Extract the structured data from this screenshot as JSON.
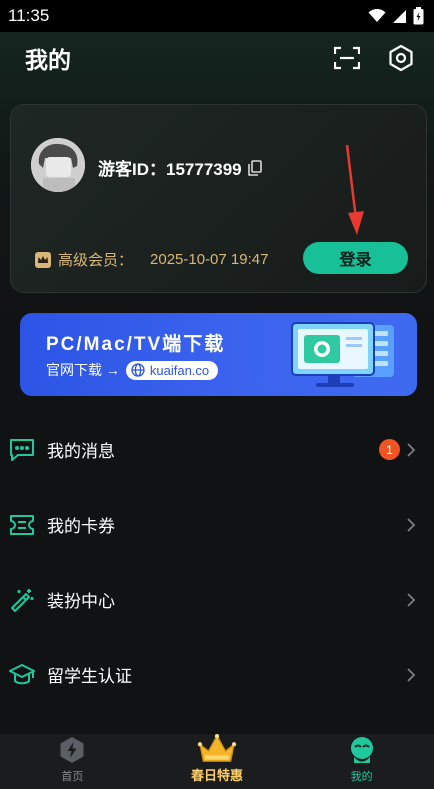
{
  "status_bar": {
    "time": "11:35"
  },
  "header": {
    "title": "我的"
  },
  "profile": {
    "guest_id": "游客ID：15777399",
    "member_label": "高级会员：",
    "member_expiry": "2025-10-07 19:47",
    "login_label": "登录"
  },
  "banner": {
    "title": "PC/Mac/TV端下载",
    "subtitle": "官网下载 →",
    "url": "kuaifan.co"
  },
  "menu": {
    "items": [
      {
        "label": "我的消息",
        "badge": "1"
      },
      {
        "label": "我的卡券"
      },
      {
        "label": "装扮中心"
      },
      {
        "label": "留学生认证"
      }
    ]
  },
  "tabbar": {
    "tabs": [
      {
        "label": "首页"
      },
      {
        "label": "春日特惠"
      },
      {
        "label": "我的"
      }
    ]
  },
  "colors": {
    "accent": "#17c096",
    "gold": "#d9b779",
    "banner": "#2c55e6",
    "badge": "#f05423"
  }
}
